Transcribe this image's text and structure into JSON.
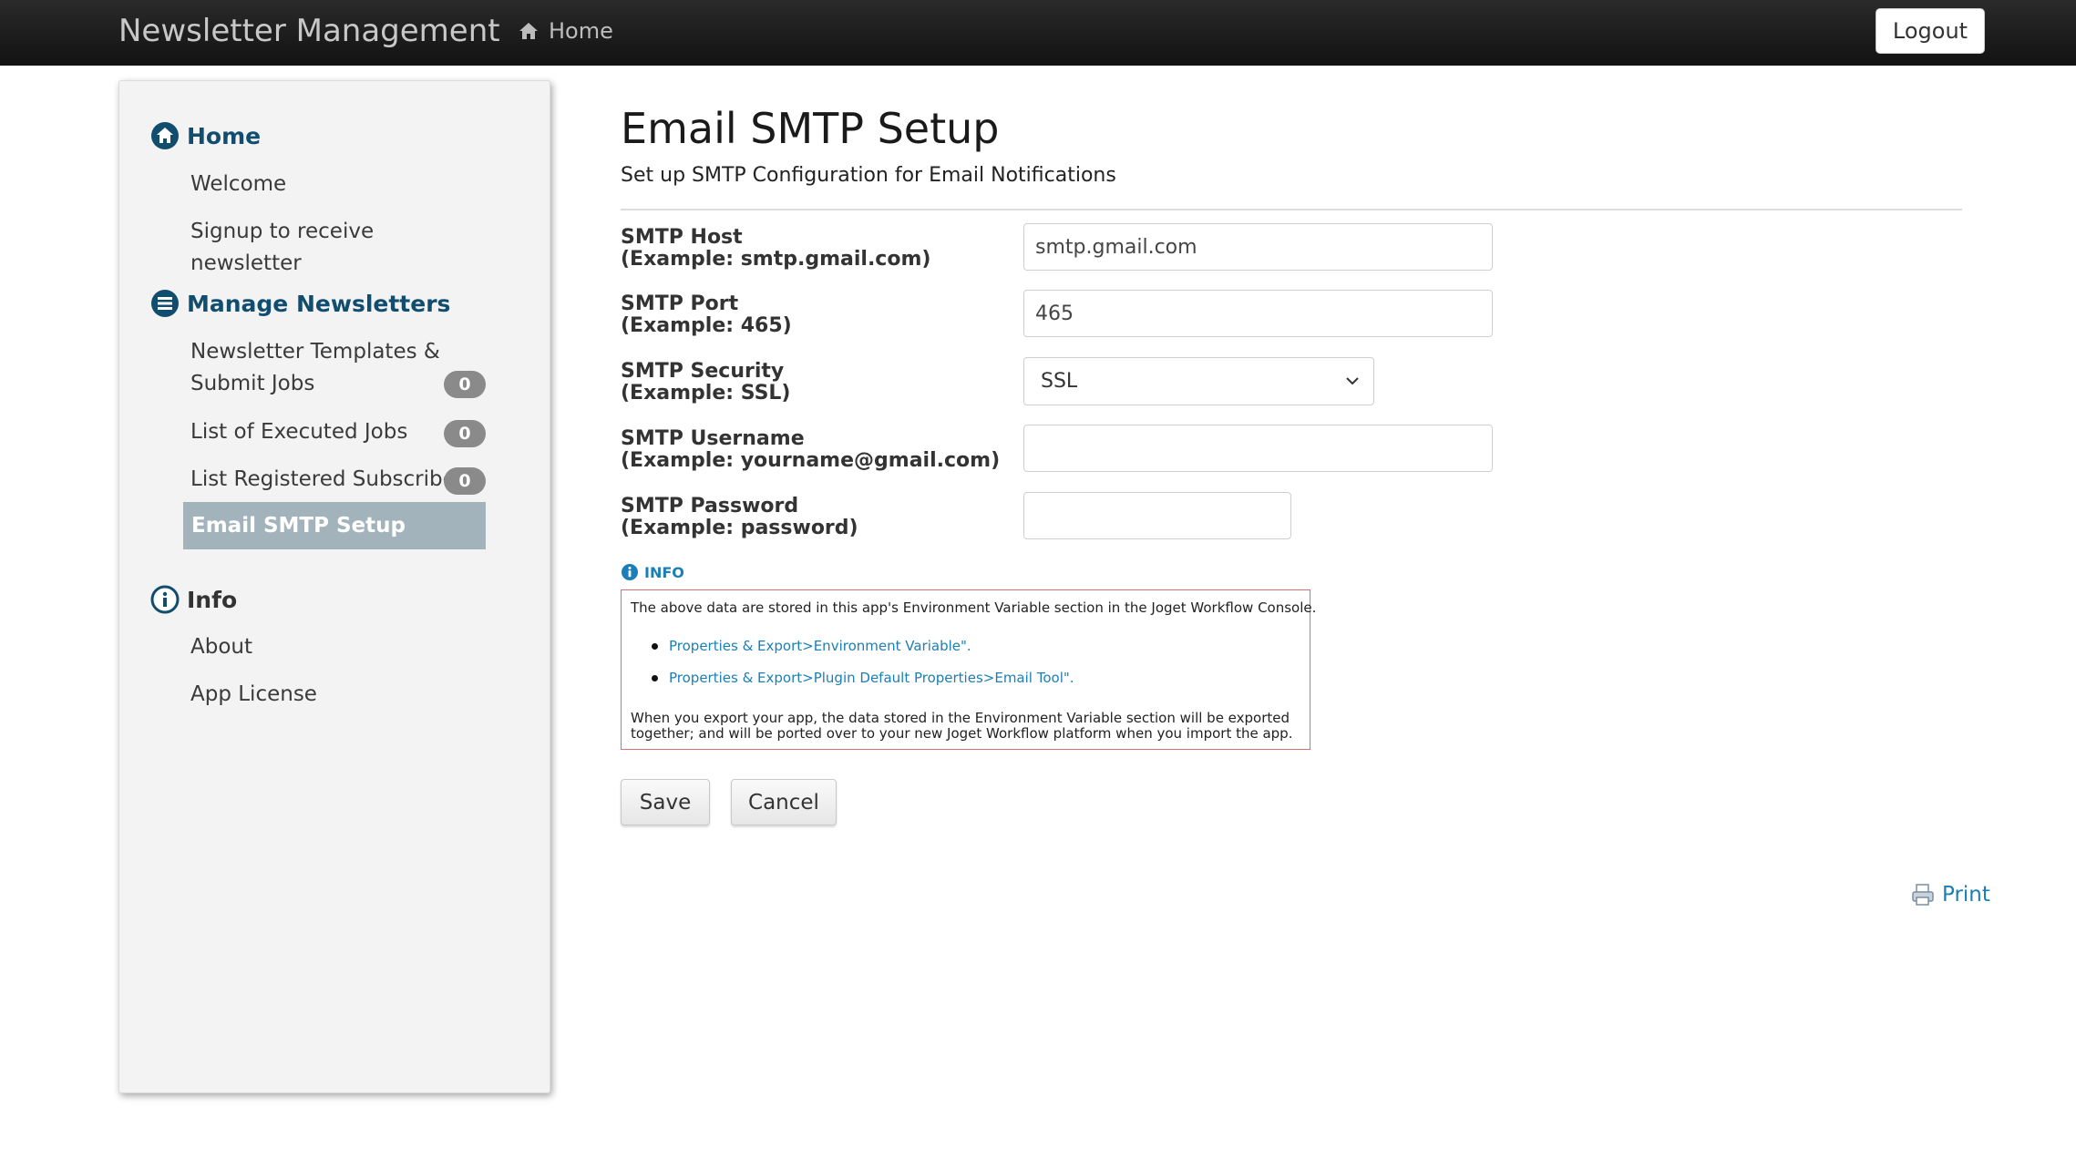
{
  "header": {
    "brand": "Newsletter Management",
    "nav_home": "Home",
    "logout_label": "Logout"
  },
  "sidebar": {
    "home": {
      "title": "Home",
      "items": [
        {
          "label": "Welcome"
        },
        {
          "label": "Signup to receive newsletter"
        }
      ]
    },
    "manage": {
      "title": "Manage Newsletters",
      "items": [
        {
          "label": "Newsletter Templates & Submit Jobs",
          "badge": "0"
        },
        {
          "label": "List of Executed Jobs",
          "badge": "0"
        },
        {
          "label": "List Registered Subscribers",
          "badge": "0"
        },
        {
          "label": "Email SMTP Setup",
          "active": true
        }
      ]
    },
    "info": {
      "title": "Info",
      "items": [
        {
          "label": "About"
        },
        {
          "label": "App License"
        }
      ]
    }
  },
  "page": {
    "title": "Email SMTP Setup",
    "subtitle": "Set up SMTP Configuration for Email Notifications"
  },
  "form": {
    "host": {
      "label": "SMTP Host",
      "example": "(Example: smtp.gmail.com)",
      "value": "smtp.gmail.com"
    },
    "port": {
      "label": "SMTP Port",
      "example": "(Example: 465)",
      "value": "465"
    },
    "security": {
      "label": "SMTP Security",
      "example": "(Example: SSL)",
      "value": "SSL"
    },
    "username": {
      "label": "SMTP Username",
      "example": "(Example: yourname@gmail.com)",
      "value": ""
    },
    "password": {
      "label": "SMTP Password",
      "example": "(Example: password)",
      "value": ""
    }
  },
  "info_box": {
    "heading": "INFO",
    "intro": "The above data are stored in this app's Environment Variable section in the Joget Workflow Console.",
    "links": [
      "Properties & Export>Environment Variable\".",
      "Properties & Export>Plugin Default Properties>Email Tool\"."
    ],
    "note": "When you export your app, the data stored in the Environment Variable section will be exported together; and will be ported over to your new Joget Workflow platform when you import the app."
  },
  "actions": {
    "save_label": "Save",
    "cancel_label": "Cancel",
    "print_label": "Print"
  },
  "colors": {
    "topbar": "#1a1a1a",
    "section_heading": "#114d6e",
    "active_item_bg": "#a2b3bb",
    "link": "#1b7fb6",
    "info_border": "#e06b6b"
  },
  "icons": {
    "home_nav": "home-icon",
    "home_section": "home-circle-icon",
    "manage_section": "newsletter-circle-icon",
    "info_section": "info-circle-icon",
    "info_heading": "info-circle-icon",
    "select": "chevron-down-icon",
    "print": "print-icon"
  }
}
